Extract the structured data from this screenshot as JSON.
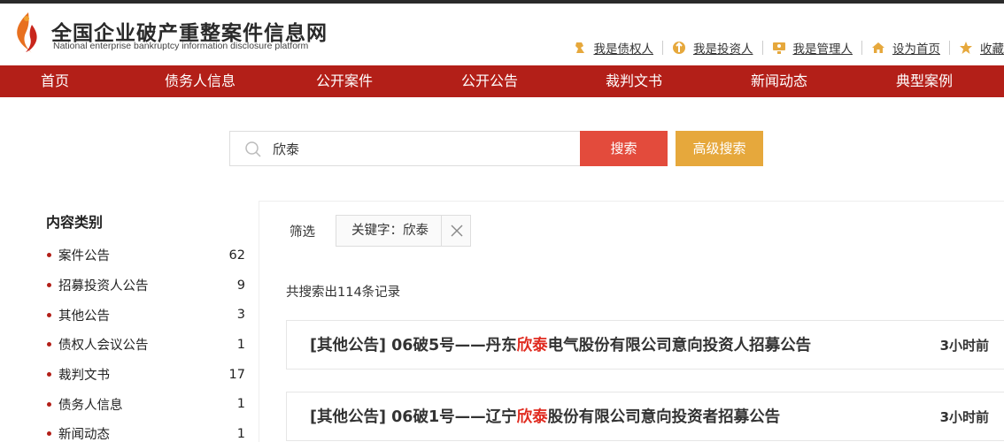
{
  "header": {
    "title": "全国企业破产重整案件信息网",
    "subtitle": "National enterprise bankruptcy  information disclosure platform",
    "links": [
      {
        "label": "我是债权人",
        "icon": "creditor-icon"
      },
      {
        "label": "我是投资人",
        "icon": "investor-icon"
      },
      {
        "label": "我是管理人",
        "icon": "administrator-icon"
      },
      {
        "label": "设为首页",
        "icon": "home-icon"
      },
      {
        "label": "收藏",
        "icon": "star-icon"
      }
    ]
  },
  "nav": {
    "items": [
      "首页",
      "债务人信息",
      "公开案件",
      "公开公告",
      "裁判文书",
      "新闻动态",
      "典型案例"
    ]
  },
  "search": {
    "value": "欣泰",
    "search_button": "搜索",
    "advanced_button": "高级搜索"
  },
  "sidebar": {
    "title": "内容类别",
    "categories": [
      {
        "label": "案件公告",
        "count": "62"
      },
      {
        "label": "招募投资人公告",
        "count": "9"
      },
      {
        "label": "其他公告",
        "count": "3"
      },
      {
        "label": "债权人会议公告",
        "count": "1"
      },
      {
        "label": "裁判文书",
        "count": "17"
      },
      {
        "label": "债务人信息",
        "count": "1"
      },
      {
        "label": "新闻动态",
        "count": "1"
      }
    ]
  },
  "filter": {
    "label": "筛选",
    "chip": "关键字：欣泰"
  },
  "results": {
    "summary": "共搜索出114条记录",
    "items": [
      {
        "prefix": "[其他公告] 06破5号——丹东",
        "highlight": "欣泰",
        "suffix": "电气股份有限公司意向投资人招募公告",
        "time": "3小时前"
      },
      {
        "prefix": "[其他公告] 06破1号——辽宁",
        "highlight": "欣泰",
        "suffix": "股份有限公司意向投资者招募公告",
        "time": "3小时前"
      }
    ]
  },
  "colors": {
    "nav_bg": "#b31f18",
    "search_button": "#e34b3c",
    "advanced_button": "#e6a83c",
    "highlight": "#e02b20"
  }
}
